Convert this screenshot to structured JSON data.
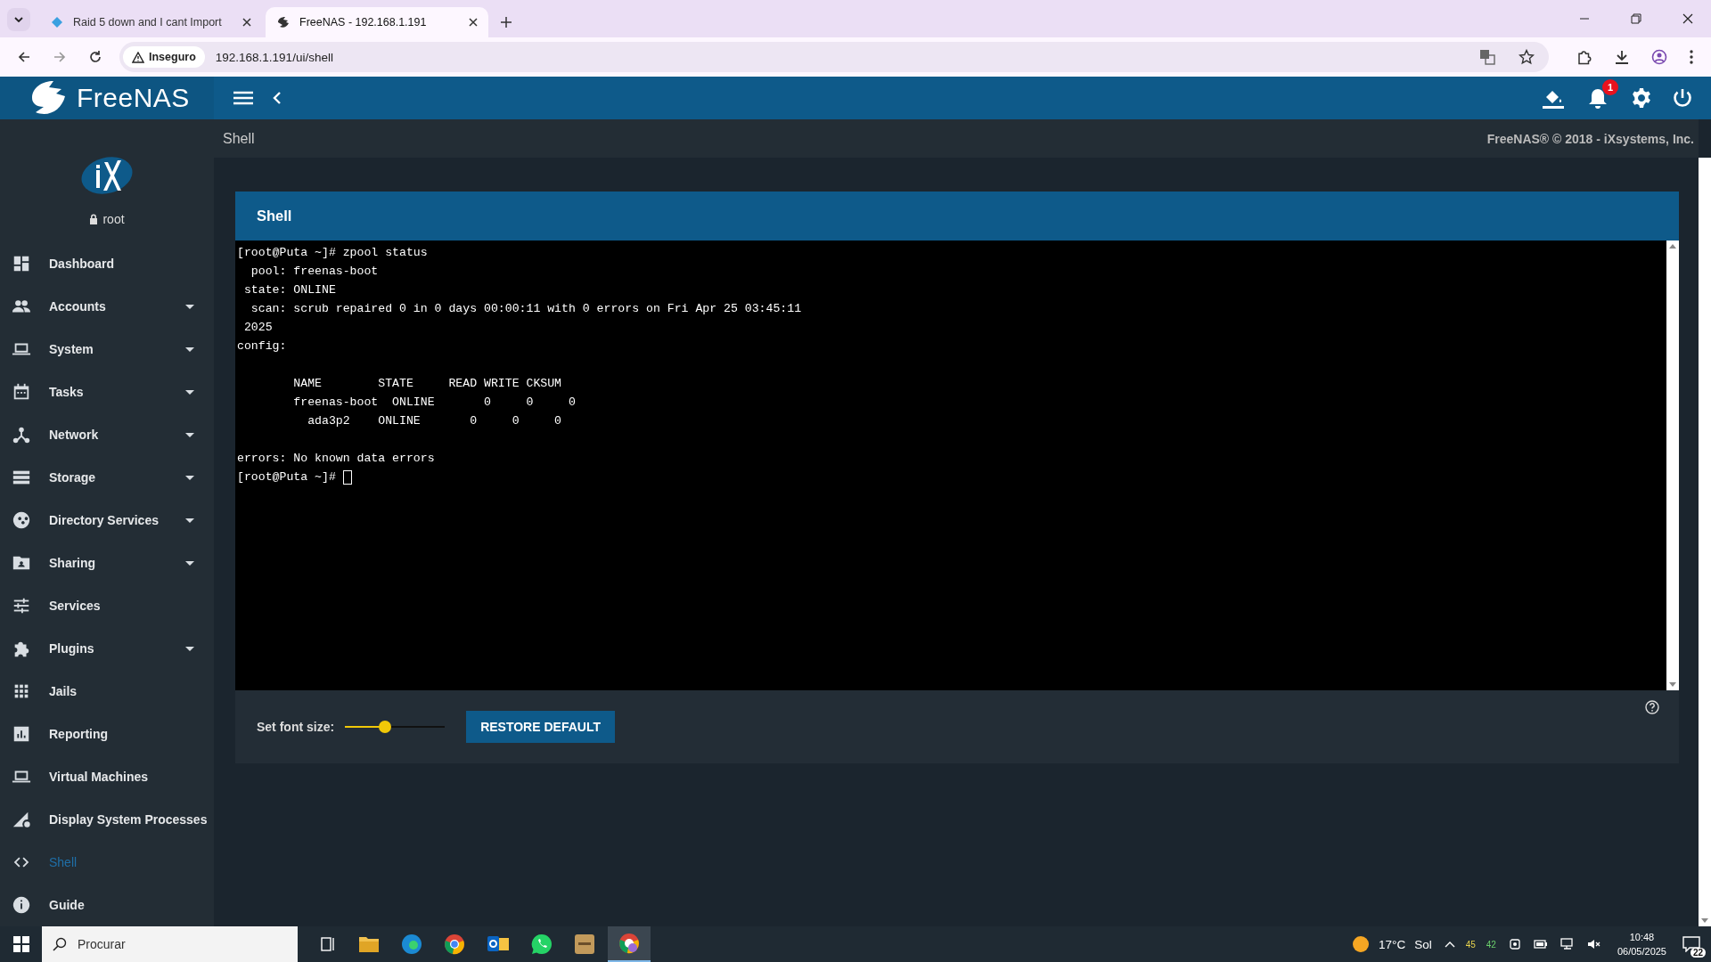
{
  "browser": {
    "tabs": [
      {
        "title": "Raid 5 down and I cant Import",
        "selected": false
      },
      {
        "title": "FreeNAS - 192.168.1.191",
        "selected": true
      }
    ],
    "security_label": "Inseguro",
    "url": "192.168.1.191/ui/shell"
  },
  "header": {
    "brand": "FreeNAS",
    "notification_count": "1"
  },
  "breadcrumb": {
    "title": "Shell",
    "copyright": "FreeNAS® © 2018 - iXsystems, Inc."
  },
  "sidebar": {
    "user": "root",
    "items": [
      {
        "label": "Dashboard",
        "has_submenu": false,
        "selected": false
      },
      {
        "label": "Accounts",
        "has_submenu": true,
        "selected": false
      },
      {
        "label": "System",
        "has_submenu": true,
        "selected": false
      },
      {
        "label": "Tasks",
        "has_submenu": true,
        "selected": false
      },
      {
        "label": "Network",
        "has_submenu": true,
        "selected": false
      },
      {
        "label": "Storage",
        "has_submenu": true,
        "selected": false
      },
      {
        "label": "Directory Services",
        "has_submenu": true,
        "selected": false
      },
      {
        "label": "Sharing",
        "has_submenu": true,
        "selected": false
      },
      {
        "label": "Services",
        "has_submenu": false,
        "selected": false
      },
      {
        "label": "Plugins",
        "has_submenu": true,
        "selected": false
      },
      {
        "label": "Jails",
        "has_submenu": false,
        "selected": false
      },
      {
        "label": "Reporting",
        "has_submenu": false,
        "selected": false
      },
      {
        "label": "Virtual Machines",
        "has_submenu": false,
        "selected": false
      },
      {
        "label": "Display System Processes",
        "has_submenu": false,
        "selected": false
      },
      {
        "label": "Shell",
        "has_submenu": false,
        "selected": true
      },
      {
        "label": "Guide",
        "has_submenu": false,
        "selected": false
      }
    ]
  },
  "shell_card": {
    "title": "Shell",
    "terminal_blocks": [
      [
        "[root@Puta ~]# zpool status",
        "  pool: freenas-boot",
        " state: ONLINE",
        "  scan: scrub repaired 0 in 0 days 00:00:11 with 0 errors on Fri Apr 25 03:45:11",
        " 2025",
        "config:"
      ],
      [
        "        NAME        STATE     READ WRITE CKSUM",
        "        freenas-boot  ONLINE       0     0     0",
        "          ada3p2    ONLINE       0     0     0"
      ],
      [
        "errors: No known data errors"
      ]
    ],
    "prompt": "[root@Puta ~]# ",
    "font_size_label": "Set font size:",
    "font_size": {
      "level": 0.4
    },
    "restore_button": "RESTORE DEFAULT"
  },
  "taskbar": {
    "search_placeholder": "Procurar",
    "temperature": "17°C",
    "weather": "Sol",
    "tray_value_1": "45",
    "tray_value_2": "42",
    "time": "10:48",
    "date": "06/05/2025",
    "notification_count": "22"
  }
}
